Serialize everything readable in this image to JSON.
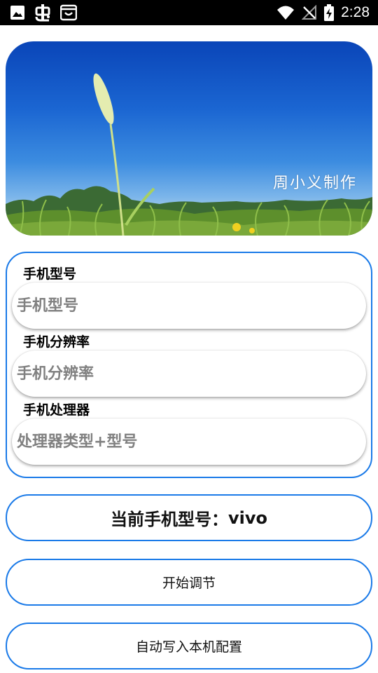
{
  "status_bar": {
    "time": "2:28",
    "left_icons": [
      "image-icon",
      "bug-app-icon",
      "shopping-bag-icon"
    ],
    "right_icons": [
      "wifi-icon",
      "no-signal-icon",
      "battery-charging-icon"
    ]
  },
  "banner": {
    "credit": "周小义制作"
  },
  "form": {
    "model": {
      "label": "手机型号",
      "placeholder": "手机型号"
    },
    "resolution": {
      "label": "手机分辨率",
      "placeholder": "手机分辨率"
    },
    "processor": {
      "label": "手机处理器",
      "placeholder": "处理器类型+型号"
    }
  },
  "current_model": {
    "prefix": "当前手机型号：",
    "value": "vivo"
  },
  "buttons": {
    "start_adjust": "开始调节",
    "auto_write": "自动写入本机配置"
  },
  "colors": {
    "accent": "#1a7ae8",
    "status_bar_bg": "#000000",
    "placeholder": "#808080"
  }
}
